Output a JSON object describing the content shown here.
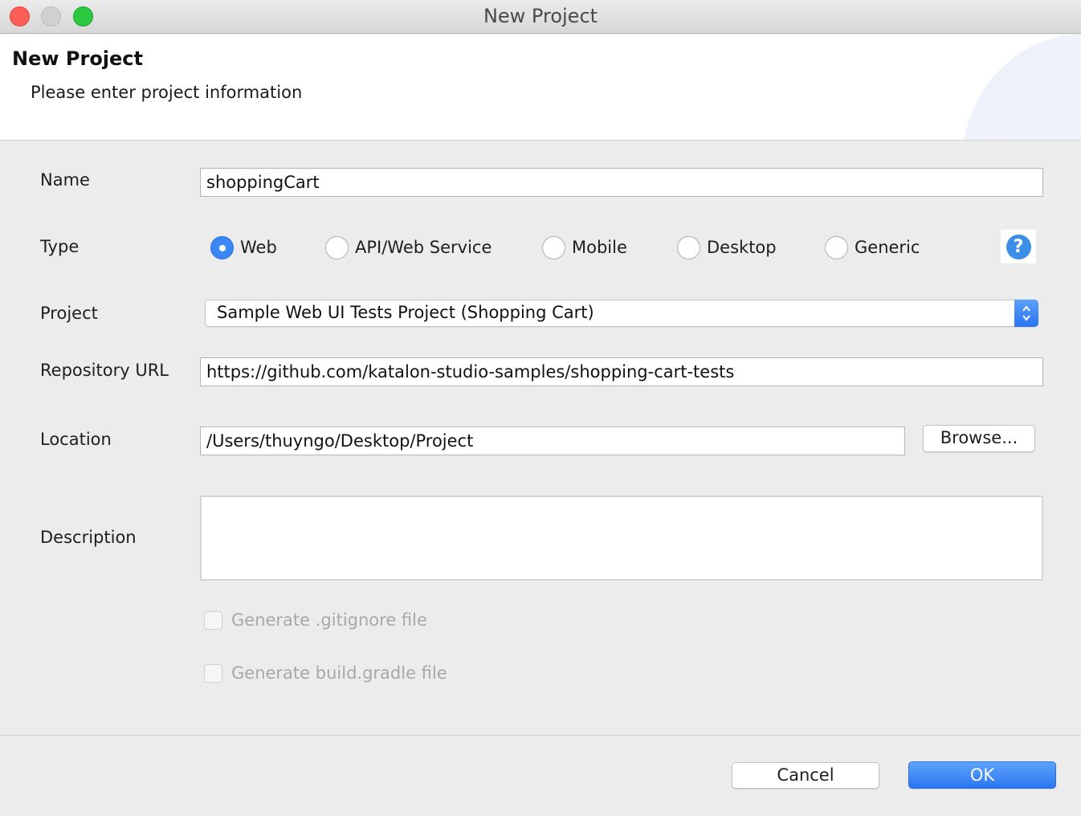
{
  "window": {
    "title": "New Project"
  },
  "banner": {
    "title": "New Project",
    "subtitle": "Please enter project information"
  },
  "form": {
    "name_label": "Name",
    "name_value": "shoppingCart",
    "type_label": "Type",
    "type_options": [
      "Web",
      "API/Web Service",
      "Mobile",
      "Desktop",
      "Generic"
    ],
    "type_selected": "Web",
    "help_icon": "?",
    "project_label": "Project",
    "project_value": "Sample Web UI Tests Project (Shopping Cart)",
    "repo_label": "Repository URL",
    "repo_value": "https://github.com/katalon-studio-samples/shopping-cart-tests",
    "location_label": "Location",
    "location_value": "/Users/thuyngo/Desktop/Project",
    "browse_label": "Browse...",
    "description_label": "Description",
    "description_value": "",
    "gitignore_label": "Generate .gitignore file",
    "gradle_label": "Generate build.gradle file"
  },
  "footer": {
    "cancel_label": "Cancel",
    "ok_label": "OK"
  },
  "colors": {
    "accent": "#3b87f7",
    "close": "#fd5f57",
    "maximize": "#2ac940"
  }
}
